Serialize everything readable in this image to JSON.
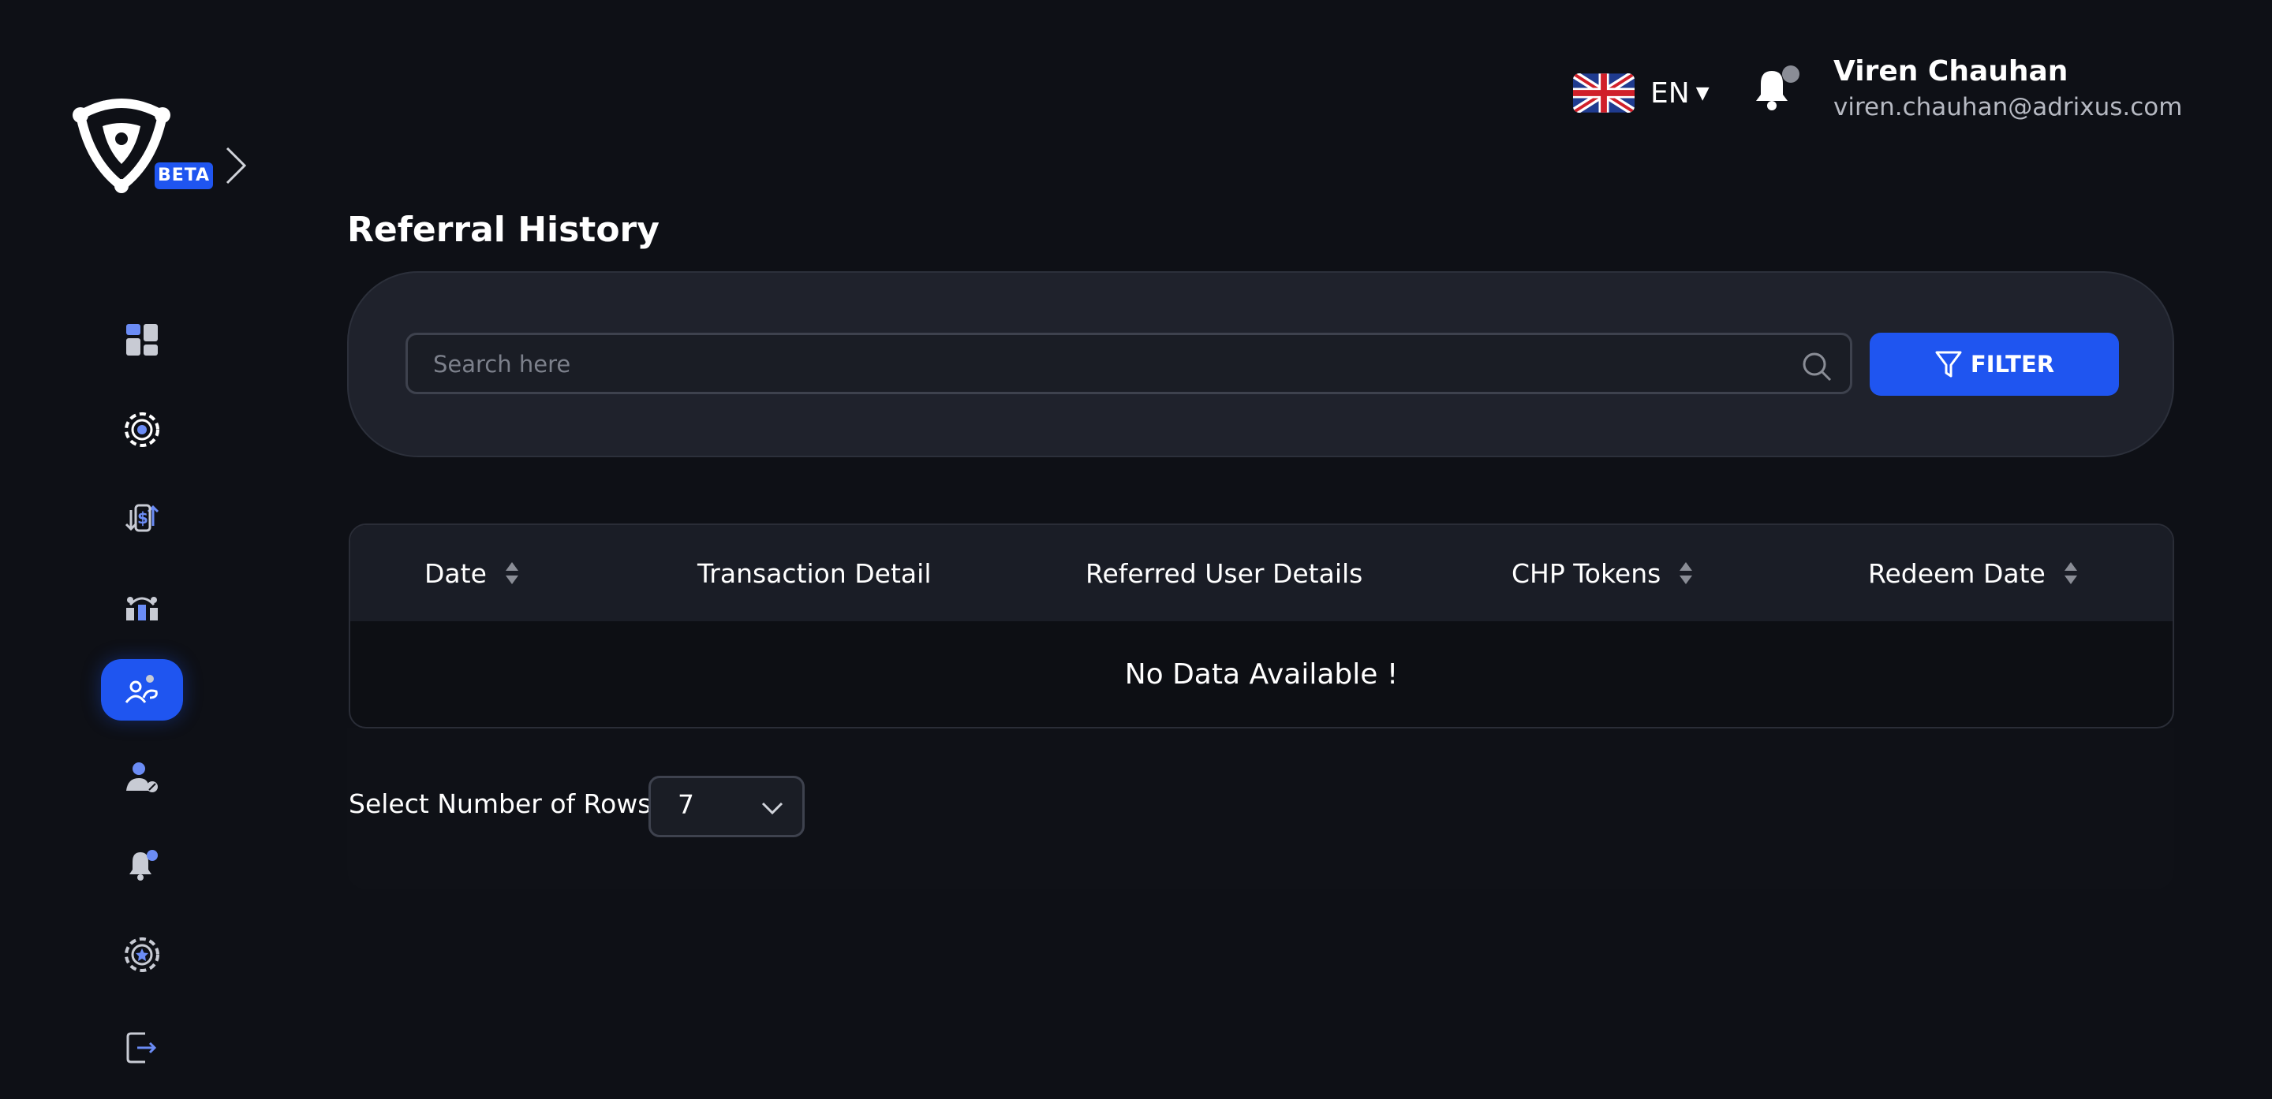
{
  "brand": {
    "badge": "BETA"
  },
  "sidebar": {
    "items": [
      {
        "name": "dashboard",
        "icon": "dashboard-icon",
        "active": false
      },
      {
        "name": "chips",
        "icon": "poker-chip-icon",
        "active": false
      },
      {
        "name": "transactions",
        "icon": "money-exchange-icon",
        "active": false
      },
      {
        "name": "community",
        "icon": "group-icon",
        "active": false
      },
      {
        "name": "referral",
        "icon": "referral-icon",
        "active": true
      },
      {
        "name": "account-settings",
        "icon": "user-settings-icon",
        "active": false
      },
      {
        "name": "notifications",
        "icon": "bell-dot-icon",
        "active": false
      },
      {
        "name": "rewards",
        "icon": "star-chip-icon",
        "active": false
      },
      {
        "name": "logout",
        "icon": "logout-icon",
        "active": false
      }
    ]
  },
  "header": {
    "language": "EN",
    "language_flag": "uk-flag-icon",
    "user": {
      "name": "Viren Chauhan",
      "email": "viren.chauhan@adrixus.com"
    }
  },
  "page": {
    "title": "Referral History"
  },
  "search": {
    "placeholder": "Search here",
    "value": ""
  },
  "filter": {
    "label": "FILTER"
  },
  "table": {
    "columns": [
      {
        "label": "Date",
        "sortable": true
      },
      {
        "label": "Transaction Detail",
        "sortable": false
      },
      {
        "label": "Referred User Details",
        "sortable": false
      },
      {
        "label": "CHP Tokens",
        "sortable": true
      },
      {
        "label": "Redeem Date",
        "sortable": true
      }
    ],
    "empty_message": "No Data Available !"
  },
  "pagination": {
    "rows_label": "Select Number of Rows",
    "rows_value": "7"
  },
  "colors": {
    "background": "#0e1016",
    "accent": "#1f55f0",
    "card": "#1f222c",
    "table_header": "#1a1d26",
    "muted_text": "#b6b9c2"
  }
}
